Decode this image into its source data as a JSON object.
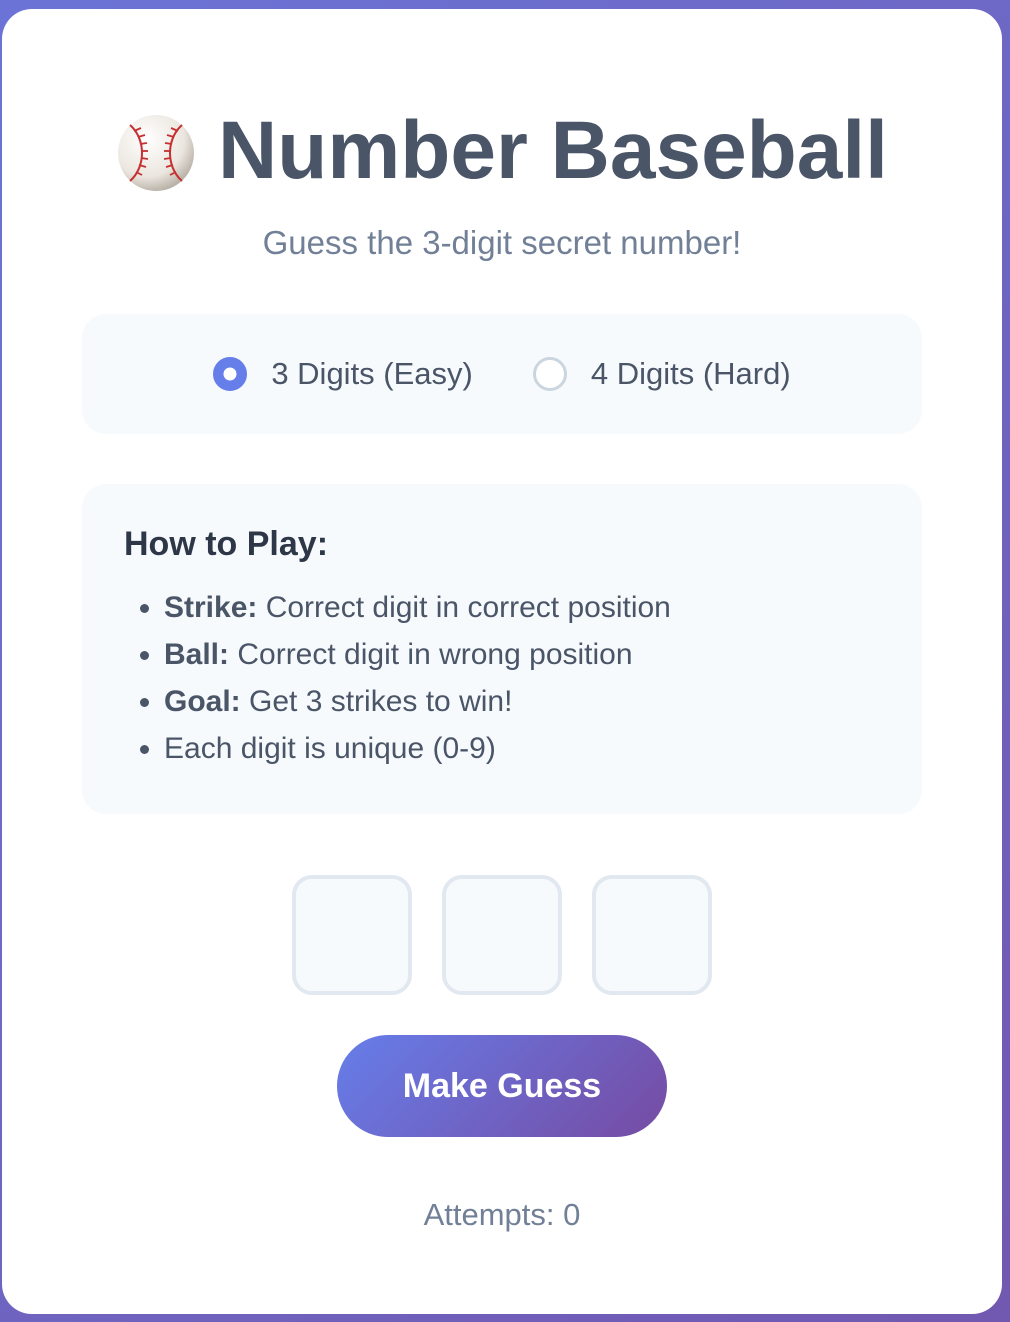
{
  "header": {
    "icon": "baseball-icon",
    "title": "Number Baseball",
    "subtitle": "Guess the 3-digit secret number!"
  },
  "mode": {
    "options": [
      {
        "label": "3 Digits (Easy)",
        "selected": true
      },
      {
        "label": "4 Digits (Hard)",
        "selected": false
      }
    ]
  },
  "how_to_play": {
    "heading": "How to Play:",
    "items": [
      {
        "term": "Strike:",
        "text": " Correct digit in correct position"
      },
      {
        "term": "Ball:",
        "text": " Correct digit in wrong position"
      },
      {
        "term": "Goal:",
        "text": " Get 3 strikes to win!"
      },
      {
        "term": "",
        "text": "Each digit is unique (0-9)"
      }
    ]
  },
  "guess": {
    "digits": [
      "",
      "",
      ""
    ],
    "button_label": "Make Guess"
  },
  "status": {
    "attempts_text": "Attempts: 0"
  },
  "colors": {
    "accent": "#667eea",
    "accent_end": "#764ba2",
    "title": "#4a5568",
    "muted": "#718096",
    "panel": "#f7fafc"
  }
}
